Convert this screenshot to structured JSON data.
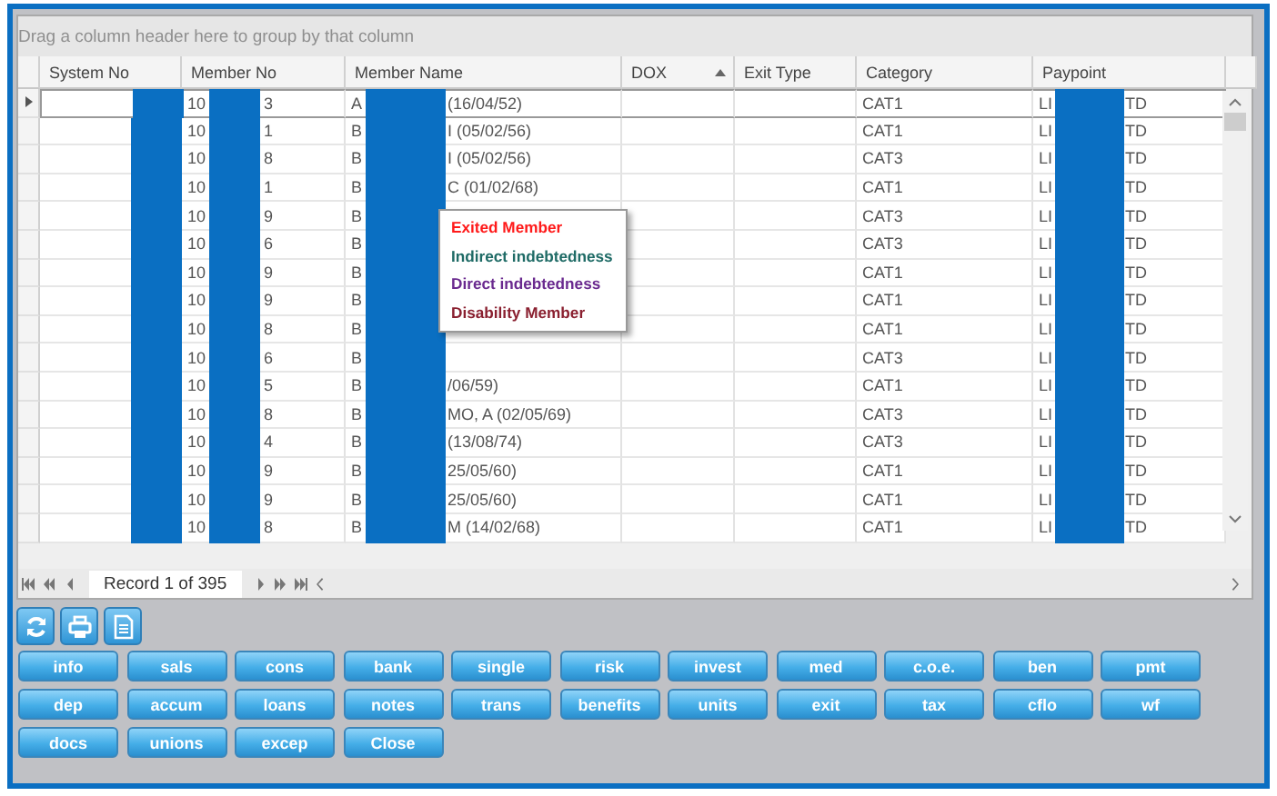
{
  "group_panel": {
    "placeholder": "Drag a column header here to group by that column"
  },
  "table": {
    "columns": [
      {
        "label": "System No",
        "sorted": false
      },
      {
        "label": "Member No",
        "sorted": false
      },
      {
        "label": "Member Name",
        "sorted": false
      },
      {
        "label": "DOX",
        "sorted": true
      },
      {
        "label": "Exit Type",
        "sorted": false
      },
      {
        "label": "Category",
        "sorted": false
      },
      {
        "label": "Paypoint",
        "sorted": false
      }
    ],
    "rows": [
      {
        "selected": true,
        "member_no": [
          "10",
          "3"
        ],
        "member_name": [
          "A",
          "(16/04/52)"
        ],
        "category": "CAT1",
        "paypoint": [
          "LI",
          "TD"
        ]
      },
      {
        "selected": false,
        "member_no": [
          "10",
          "1"
        ],
        "member_name": [
          "B",
          "I (05/02/56)"
        ],
        "category": "CAT1",
        "paypoint": [
          "LI",
          "TD"
        ]
      },
      {
        "selected": false,
        "member_no": [
          "10",
          "8"
        ],
        "member_name": [
          "B",
          "I (05/02/56)"
        ],
        "category": "CAT3",
        "paypoint": [
          "LI",
          "TD"
        ]
      },
      {
        "selected": false,
        "member_no": [
          "10",
          "1"
        ],
        "member_name": [
          "B",
          "C (01/02/68)"
        ],
        "category": "CAT1",
        "paypoint": [
          "LI",
          "TD"
        ]
      },
      {
        "selected": false,
        "member_no": [
          "10",
          "9"
        ],
        "member_name": [
          "B"
        ],
        "category": "CAT3",
        "paypoint": [
          "LI",
          "TD"
        ]
      },
      {
        "selected": false,
        "member_no": [
          "10",
          "6"
        ],
        "member_name": [
          "B"
        ],
        "category": "CAT3",
        "paypoint": [
          "LI",
          "TD"
        ]
      },
      {
        "selected": false,
        "member_no": [
          "10",
          "9"
        ],
        "member_name": [
          "B"
        ],
        "category": "CAT1",
        "paypoint": [
          "LI",
          "TD"
        ]
      },
      {
        "selected": false,
        "member_no": [
          "10",
          "9"
        ],
        "member_name": [
          "B"
        ],
        "category": "CAT1",
        "paypoint": [
          "LI",
          "TD"
        ]
      },
      {
        "selected": false,
        "member_no": [
          "10",
          "8"
        ],
        "member_name": [
          "B"
        ],
        "category": "CAT1",
        "paypoint": [
          "LI",
          "TD"
        ]
      },
      {
        "selected": false,
        "member_no": [
          "10",
          "6"
        ],
        "member_name": [
          "B"
        ],
        "category": "CAT3",
        "paypoint": [
          "LI",
          "TD"
        ]
      },
      {
        "selected": false,
        "member_no": [
          "10",
          "5"
        ],
        "member_name": [
          "B",
          "/06/59)"
        ],
        "category": "CAT1",
        "paypoint": [
          "LI",
          "TD"
        ]
      },
      {
        "selected": false,
        "member_no": [
          "10",
          "8"
        ],
        "member_name": [
          "B",
          "MO, A (02/05/69)"
        ],
        "category": "CAT3",
        "paypoint": [
          "LI",
          "TD"
        ]
      },
      {
        "selected": false,
        "member_no": [
          "10",
          "4"
        ],
        "member_name": [
          "B",
          "(13/08/74)"
        ],
        "category": "CAT3",
        "paypoint": [
          "LI",
          "TD"
        ]
      },
      {
        "selected": false,
        "member_no": [
          "10",
          "9"
        ],
        "member_name": [
          "B",
          "25/05/60)"
        ],
        "category": "CAT1",
        "paypoint": [
          "LI",
          "TD"
        ]
      },
      {
        "selected": false,
        "member_no": [
          "10",
          "9"
        ],
        "member_name": [
          "B",
          "25/05/60)"
        ],
        "category": "CAT1",
        "paypoint": [
          "LI",
          "TD"
        ]
      },
      {
        "selected": false,
        "member_no": [
          "10",
          "8"
        ],
        "member_name": [
          "B",
          "M (14/02/68)"
        ],
        "category": "CAT1",
        "paypoint": [
          "LI",
          "TD"
        ]
      }
    ]
  },
  "legend_menu": [
    {
      "label": "Exited Member",
      "color": "#ff1a1a"
    },
    {
      "label": "Indirect indebtedness",
      "color": "#1f6b66"
    },
    {
      "label": "Direct indebtedness",
      "color": "#6a2a8f"
    },
    {
      "label": "Disability Member",
      "color": "#8a2030"
    }
  ],
  "navigator": {
    "record": "Record 1 of 395"
  },
  "toolbar": [
    {
      "kind": "refresh"
    },
    {
      "kind": "print"
    },
    {
      "kind": "document"
    }
  ],
  "buttons": [
    "info",
    "sals",
    "cons",
    "bank",
    "single",
    "risk",
    "invest",
    "med",
    "c.o.e.",
    "ben",
    "pmt",
    "dep",
    "accum",
    "loans",
    "notes",
    "trans",
    "benefits",
    "units",
    "exit",
    "tax",
    "cflo",
    "wf",
    "docs",
    "unions",
    "excep",
    "Close"
  ]
}
